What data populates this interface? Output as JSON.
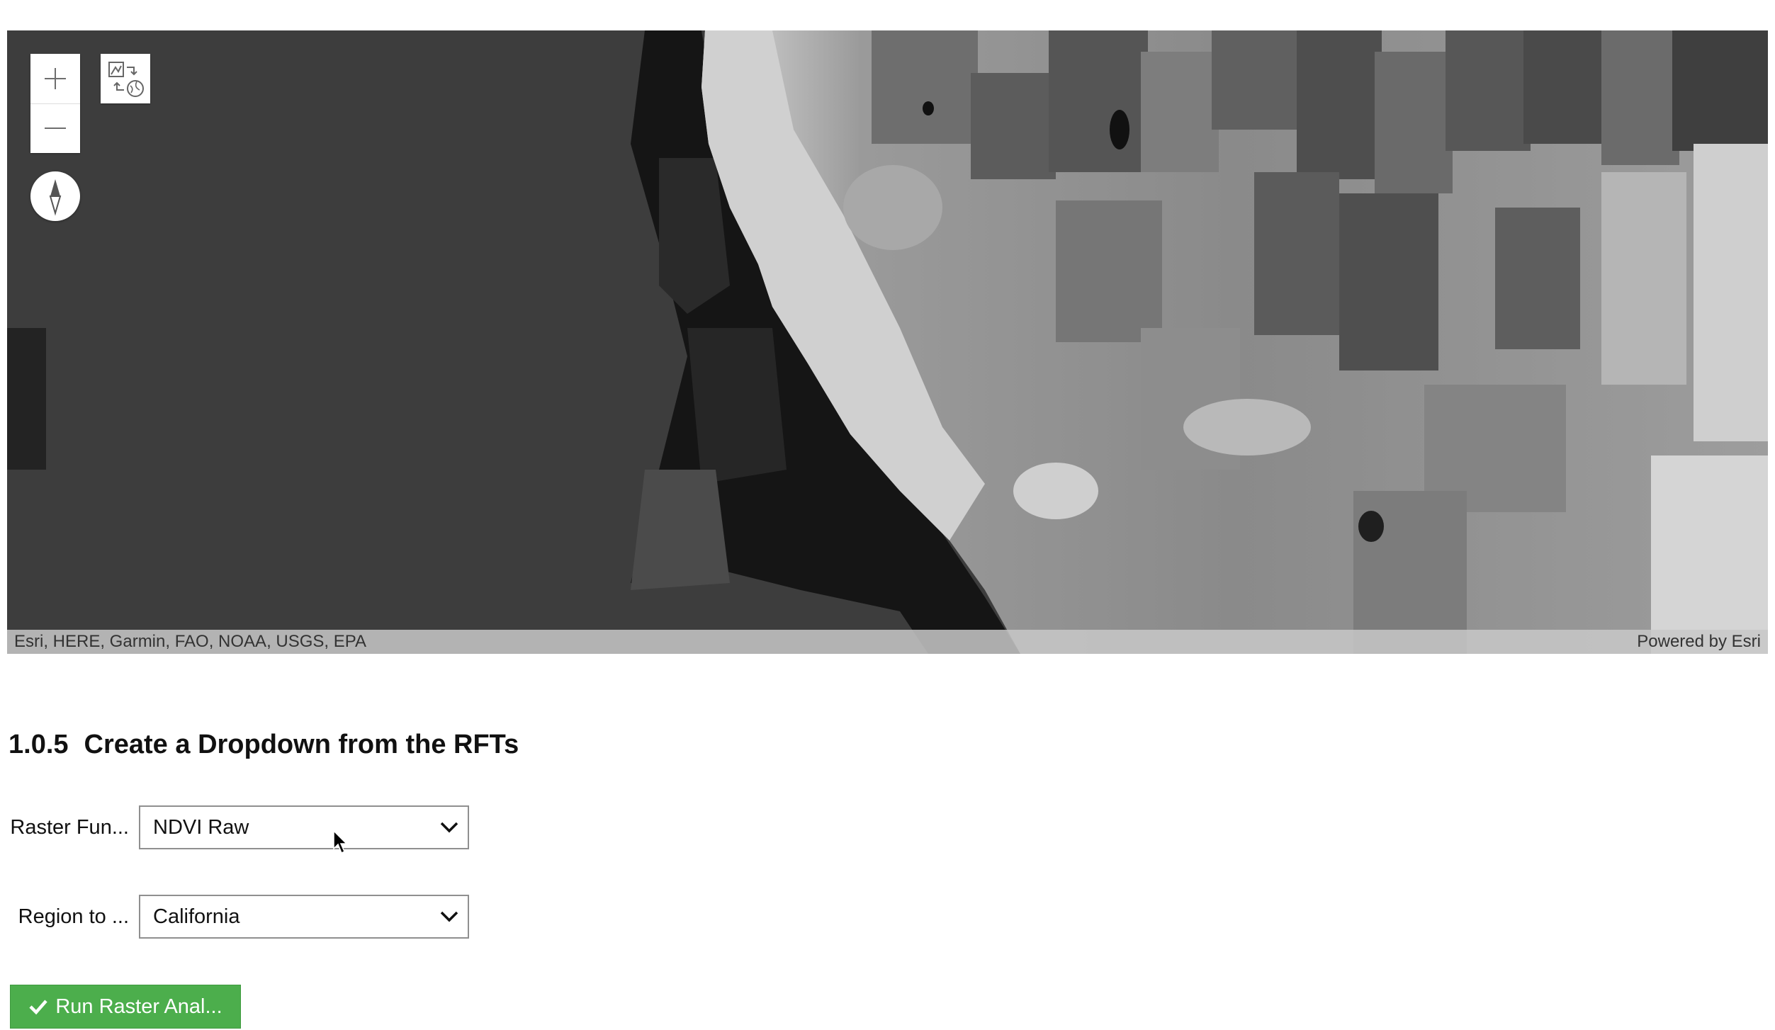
{
  "map": {
    "attribution_left": "Esri, HERE, Garmin, FAO, NOAA, USGS, EPA",
    "attribution_right": "Powered by Esri",
    "controls": {
      "zoom_in_icon": "plus-icon",
      "zoom_out_icon": "minus-icon",
      "swipe_icon": "swipe-layers-icon",
      "compass_icon": "compass-icon"
    }
  },
  "section": {
    "number": "1.0.5",
    "title": "Create a Dropdown from the RFTs"
  },
  "form": {
    "raster_function": {
      "label": "Raster Fun...",
      "selected": "NDVI Raw"
    },
    "region": {
      "label": "Region to ...",
      "selected": "California"
    },
    "run_button": {
      "label": "Run Raster Anal...",
      "icon": "check-icon",
      "color": "#4cae4c"
    }
  }
}
